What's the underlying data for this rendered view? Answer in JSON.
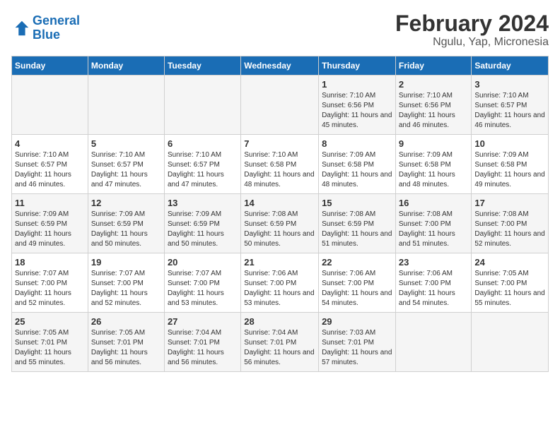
{
  "header": {
    "logo_line1": "General",
    "logo_line2": "Blue",
    "title": "February 2024",
    "subtitle": "Ngulu, Yap, Micronesia"
  },
  "columns": [
    "Sunday",
    "Monday",
    "Tuesday",
    "Wednesday",
    "Thursday",
    "Friday",
    "Saturday"
  ],
  "weeks": [
    [
      {
        "day": "",
        "info": ""
      },
      {
        "day": "",
        "info": ""
      },
      {
        "day": "",
        "info": ""
      },
      {
        "day": "",
        "info": ""
      },
      {
        "day": "1",
        "info": "Sunrise: 7:10 AM\nSunset: 6:56 PM\nDaylight: 11 hours and 45 minutes."
      },
      {
        "day": "2",
        "info": "Sunrise: 7:10 AM\nSunset: 6:56 PM\nDaylight: 11 hours and 46 minutes."
      },
      {
        "day": "3",
        "info": "Sunrise: 7:10 AM\nSunset: 6:57 PM\nDaylight: 11 hours and 46 minutes."
      }
    ],
    [
      {
        "day": "4",
        "info": "Sunrise: 7:10 AM\nSunset: 6:57 PM\nDaylight: 11 hours and 46 minutes."
      },
      {
        "day": "5",
        "info": "Sunrise: 7:10 AM\nSunset: 6:57 PM\nDaylight: 11 hours and 47 minutes."
      },
      {
        "day": "6",
        "info": "Sunrise: 7:10 AM\nSunset: 6:57 PM\nDaylight: 11 hours and 47 minutes."
      },
      {
        "day": "7",
        "info": "Sunrise: 7:10 AM\nSunset: 6:58 PM\nDaylight: 11 hours and 48 minutes."
      },
      {
        "day": "8",
        "info": "Sunrise: 7:09 AM\nSunset: 6:58 PM\nDaylight: 11 hours and 48 minutes."
      },
      {
        "day": "9",
        "info": "Sunrise: 7:09 AM\nSunset: 6:58 PM\nDaylight: 11 hours and 48 minutes."
      },
      {
        "day": "10",
        "info": "Sunrise: 7:09 AM\nSunset: 6:58 PM\nDaylight: 11 hours and 49 minutes."
      }
    ],
    [
      {
        "day": "11",
        "info": "Sunrise: 7:09 AM\nSunset: 6:59 PM\nDaylight: 11 hours and 49 minutes."
      },
      {
        "day": "12",
        "info": "Sunrise: 7:09 AM\nSunset: 6:59 PM\nDaylight: 11 hours and 50 minutes."
      },
      {
        "day": "13",
        "info": "Sunrise: 7:09 AM\nSunset: 6:59 PM\nDaylight: 11 hours and 50 minutes."
      },
      {
        "day": "14",
        "info": "Sunrise: 7:08 AM\nSunset: 6:59 PM\nDaylight: 11 hours and 50 minutes."
      },
      {
        "day": "15",
        "info": "Sunrise: 7:08 AM\nSunset: 6:59 PM\nDaylight: 11 hours and 51 minutes."
      },
      {
        "day": "16",
        "info": "Sunrise: 7:08 AM\nSunset: 7:00 PM\nDaylight: 11 hours and 51 minutes."
      },
      {
        "day": "17",
        "info": "Sunrise: 7:08 AM\nSunset: 7:00 PM\nDaylight: 11 hours and 52 minutes."
      }
    ],
    [
      {
        "day": "18",
        "info": "Sunrise: 7:07 AM\nSunset: 7:00 PM\nDaylight: 11 hours and 52 minutes."
      },
      {
        "day": "19",
        "info": "Sunrise: 7:07 AM\nSunset: 7:00 PM\nDaylight: 11 hours and 52 minutes."
      },
      {
        "day": "20",
        "info": "Sunrise: 7:07 AM\nSunset: 7:00 PM\nDaylight: 11 hours and 53 minutes."
      },
      {
        "day": "21",
        "info": "Sunrise: 7:06 AM\nSunset: 7:00 PM\nDaylight: 11 hours and 53 minutes."
      },
      {
        "day": "22",
        "info": "Sunrise: 7:06 AM\nSunset: 7:00 PM\nDaylight: 11 hours and 54 minutes."
      },
      {
        "day": "23",
        "info": "Sunrise: 7:06 AM\nSunset: 7:00 PM\nDaylight: 11 hours and 54 minutes."
      },
      {
        "day": "24",
        "info": "Sunrise: 7:05 AM\nSunset: 7:00 PM\nDaylight: 11 hours and 55 minutes."
      }
    ],
    [
      {
        "day": "25",
        "info": "Sunrise: 7:05 AM\nSunset: 7:01 PM\nDaylight: 11 hours and 55 minutes."
      },
      {
        "day": "26",
        "info": "Sunrise: 7:05 AM\nSunset: 7:01 PM\nDaylight: 11 hours and 56 minutes."
      },
      {
        "day": "27",
        "info": "Sunrise: 7:04 AM\nSunset: 7:01 PM\nDaylight: 11 hours and 56 minutes."
      },
      {
        "day": "28",
        "info": "Sunrise: 7:04 AM\nSunset: 7:01 PM\nDaylight: 11 hours and 56 minutes."
      },
      {
        "day": "29",
        "info": "Sunrise: 7:03 AM\nSunset: 7:01 PM\nDaylight: 11 hours and 57 minutes."
      },
      {
        "day": "",
        "info": ""
      },
      {
        "day": "",
        "info": ""
      }
    ]
  ]
}
